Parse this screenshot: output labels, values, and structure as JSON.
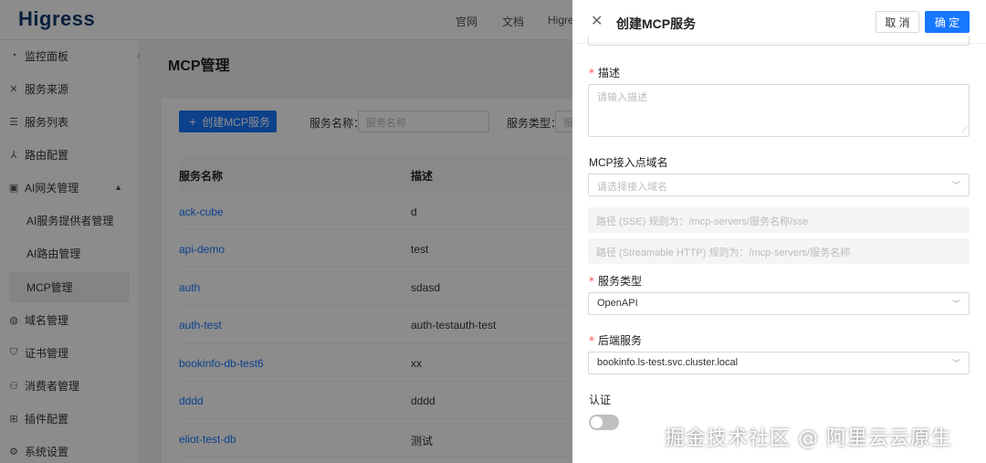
{
  "header": {
    "logo": "Higress",
    "nav": [
      "官网",
      "文档",
      "Higre"
    ]
  },
  "sidebar": {
    "items": [
      {
        "label": "监控面板",
        "icon": "dashboard-icon"
      },
      {
        "label": "服务来源",
        "icon": "service-source-icon"
      },
      {
        "label": "服务列表",
        "icon": "list-icon"
      },
      {
        "label": "路由配置",
        "icon": "route-icon"
      },
      {
        "label": "AI网关管理",
        "icon": "ai-gateway-icon"
      },
      {
        "label": "AI服务提供者管理"
      },
      {
        "label": "AI路由管理"
      },
      {
        "label": "MCP管理"
      },
      {
        "label": "域名管理",
        "icon": "globe-icon"
      },
      {
        "label": "证书管理",
        "icon": "shield-icon"
      },
      {
        "label": "消费者管理",
        "icon": "user-icon"
      },
      {
        "label": "插件配置",
        "icon": "plugin-icon"
      },
      {
        "label": "系统设置",
        "icon": "gear-icon"
      }
    ]
  },
  "main": {
    "title": "MCP管理",
    "create_button": "创建MCP服务",
    "filter_name_label": "服务名称：",
    "filter_name_placeholder": "服务名称",
    "filter_type_label": "服务类型：",
    "filter_type_placeholder": "服",
    "columns": [
      "服务名称",
      "描述"
    ],
    "rows": [
      {
        "name": "ack-cube",
        "desc": "d"
      },
      {
        "name": "api-demo",
        "desc": "test"
      },
      {
        "name": "auth",
        "desc": "sdasd"
      },
      {
        "name": "auth-test",
        "desc": "auth-testauth-test"
      },
      {
        "name": "bookinfo-db-test6",
        "desc": "xx"
      },
      {
        "name": "dddd",
        "desc": "dddd"
      },
      {
        "name": "eliot-test-db",
        "desc": "测试"
      }
    ]
  },
  "drawer": {
    "title": "创建MCP服务",
    "cancel": "取 消",
    "ok": "确 定",
    "desc_label": "描述",
    "desc_placeholder": "请输入描述",
    "domain_label": "MCP接入点域名",
    "domain_placeholder": "请选择接入域名",
    "sse_path": "路径 (SSE) 规则为：/mcp-servers/服务名称/sse",
    "http_path": "路径 (Streamable HTTP) 规则为：/mcp-servers/服务名称",
    "type_label": "服务类型",
    "type_value": "OpenAPI",
    "backend_label": "后端服务",
    "backend_value": "bookinfo.ls-test.svc.cluster.local",
    "auth_label": "认证",
    "auth_enabled": false
  },
  "watermark": "掘金技术社区 @ 阿里云云原生",
  "colors": {
    "primary": "#1677ff",
    "required": "#ff4d4f"
  }
}
